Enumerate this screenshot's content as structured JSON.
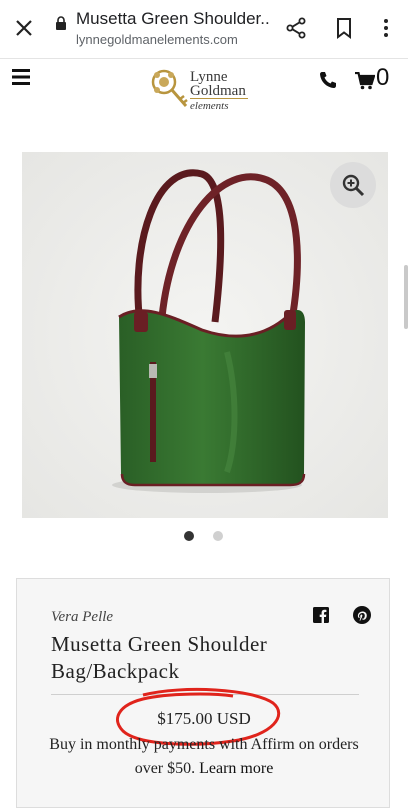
{
  "browser": {
    "title": "Musetta Green Shoulder...",
    "url": "lynnegoldmanelements.com",
    "close_icon": "close-icon",
    "lock_icon": "lock-icon",
    "share_icon": "share-icon",
    "bookmark_icon": "bookmark-icon",
    "more_icon": "more-vertical-icon"
  },
  "header": {
    "logo": {
      "line1": "Lynne",
      "line2": "Goldman",
      "line3": "elements"
    },
    "menu_icon": "hamburger-menu-icon",
    "phone_icon": "phone-icon",
    "cart_icon": "cart-icon",
    "cart_count": "0"
  },
  "gallery": {
    "zoom_icon": "zoom-in-icon",
    "image_count": 2,
    "active_index": 0
  },
  "product": {
    "brand": "Vera Pelle",
    "title_line1": "Musetta Green Shoulder",
    "title_line2": "Bag/Backpack",
    "price": "$175.00 USD",
    "affirm_text": "Buy in monthly payments with Affirm on orders over $50.",
    "learn_more": "Learn more",
    "facebook_icon": "facebook-icon",
    "pinterest_icon": "pinterest-icon"
  },
  "colors": {
    "bag_green": "#2f6b2a",
    "strap_burgundy": "#6a1f24",
    "annotation_red": "#e0241c"
  }
}
